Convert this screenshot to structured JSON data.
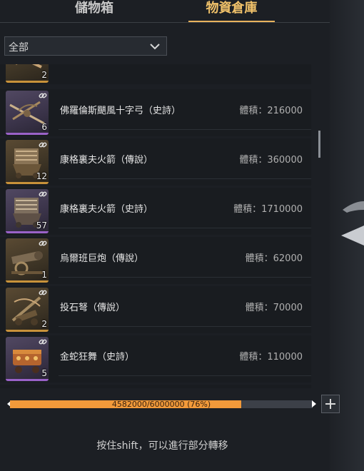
{
  "tabs": [
    {
      "label": "儲物箱",
      "active": false
    },
    {
      "label": "物資倉庫",
      "active": true
    }
  ],
  "filter": {
    "selected": "全部"
  },
  "items": [
    {
      "name": "",
      "volume": "",
      "count": "2",
      "rarity": "gold",
      "icon": "crossbow-icon"
    },
    {
      "name": "佛羅倫斯颶風十字弓（史詩）",
      "volume": "體積：216000",
      "count": "6",
      "rarity": "purple",
      "icon": "crossbow-icon"
    },
    {
      "name": "康格裏夫火箭（傳說）",
      "volume": "體積：360000",
      "count": "12",
      "rarity": "gold",
      "icon": "rocket-launcher-icon"
    },
    {
      "name": "康格裏夫火箭（史詩）",
      "volume": "體積：1710000",
      "count": "57",
      "rarity": "purple",
      "icon": "rocket-launcher-icon"
    },
    {
      "name": "烏爾班巨炮（傳說）",
      "volume": "體積：62000",
      "count": "1",
      "rarity": "gold",
      "icon": "cannon-icon"
    },
    {
      "name": "投石弩（傳說）",
      "volume": "體積：70000",
      "count": "2",
      "rarity": "gold",
      "icon": "ballista-icon"
    },
    {
      "name": "金蛇狂舞（史詩）",
      "volume": "體積：110000",
      "count": "5",
      "rarity": "purple",
      "icon": "firework-cart-icon"
    }
  ],
  "capacity": {
    "text": "4582000/6000000 (76%)",
    "fraction": 0.7637
  },
  "hint": "按住shift，可以進行部分轉移",
  "colors": {
    "accent": "#e8b35c",
    "bar": "#f29a3a",
    "gold": "#c8923a",
    "purple": "#9a62c8"
  }
}
